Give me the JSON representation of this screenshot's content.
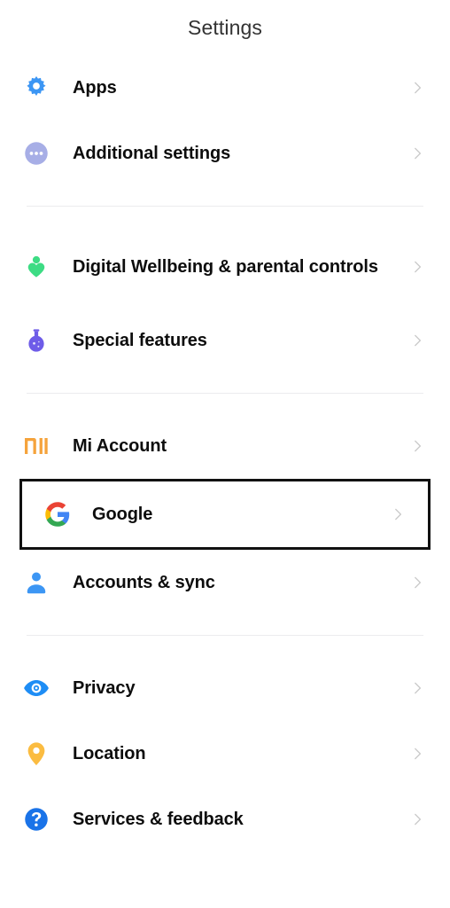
{
  "header": {
    "title": "Settings"
  },
  "chevron_icon": "chevron-right-icon",
  "colors": {
    "background": "#ffffff",
    "title_text": "#333333",
    "label_text": "#0d0d0d",
    "divider": "#ececee",
    "chevron": "#c9c9c9",
    "selection_border": "#111111",
    "apps_blue": "#3c96f4",
    "additional_settings_periwinkle": "#a7aee6",
    "wellbeing_green": "#3ddc84",
    "special_features_purple": "#6e5ce8",
    "mi_orange": "#f5a33c",
    "accounts_blue": "#3c96f4",
    "privacy_blue": "#1e8df5",
    "location_amber": "#fbbc41",
    "services_blue": "#1a73e8"
  },
  "groups": [
    {
      "id": "group-apps",
      "items": [
        {
          "id": "apps",
          "label": "Apps",
          "icon": "gear-icon",
          "selected": false,
          "tall": false
        },
        {
          "id": "additional-settings",
          "label": "Additional settings",
          "icon": "ellipsis-circle-icon",
          "selected": false,
          "tall": false
        }
      ]
    },
    {
      "id": "group-wellbeing",
      "items": [
        {
          "id": "digital-wellbeing",
          "label": "Digital Wellbeing & parental controls",
          "icon": "person-heart-icon",
          "selected": false,
          "tall": true
        },
        {
          "id": "special-features",
          "label": "Special features",
          "icon": "flask-icon",
          "selected": false,
          "tall": false
        }
      ]
    },
    {
      "id": "group-accounts",
      "items": [
        {
          "id": "mi-account",
          "label": "Mi Account",
          "icon": "mi-logo-icon",
          "selected": false,
          "tall": false
        },
        {
          "id": "google",
          "label": "Google",
          "icon": "google-logo-icon",
          "selected": true,
          "tall": false
        },
        {
          "id": "accounts-sync",
          "label": "Accounts & sync",
          "icon": "person-icon",
          "selected": false,
          "tall": false
        }
      ]
    },
    {
      "id": "group-privacy",
      "items": [
        {
          "id": "privacy",
          "label": "Privacy",
          "icon": "eye-icon",
          "selected": false,
          "tall": false
        },
        {
          "id": "location",
          "label": "Location",
          "icon": "location-pin-icon",
          "selected": false,
          "tall": false
        },
        {
          "id": "services-feedback",
          "label": "Services & feedback",
          "icon": "question-circle-icon",
          "selected": false,
          "tall": false
        }
      ]
    }
  ]
}
